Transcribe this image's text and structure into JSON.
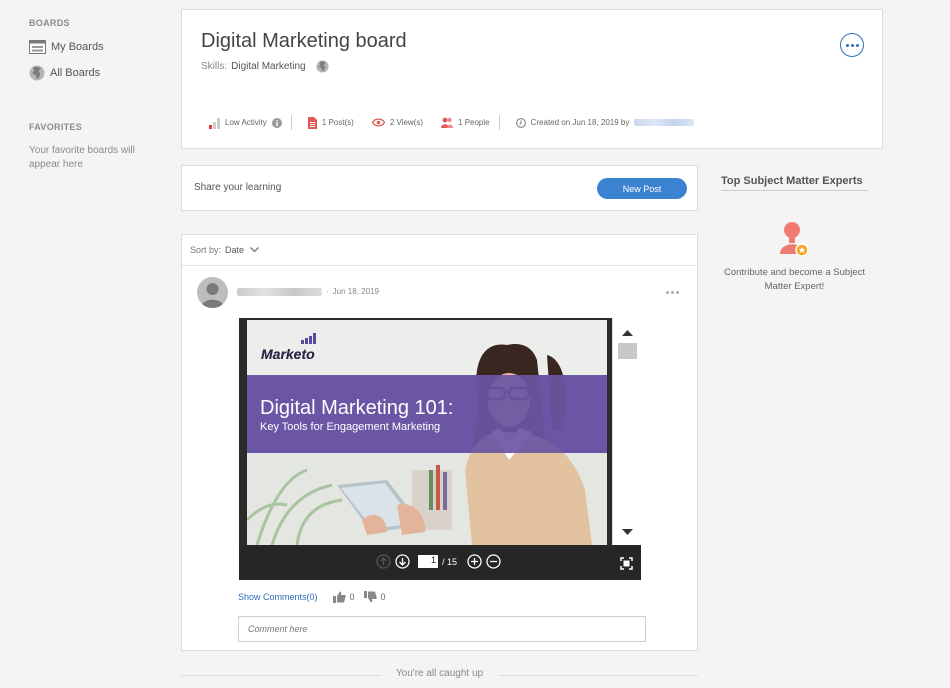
{
  "sidebar": {
    "boards_heading": "BOARDS",
    "items": [
      {
        "label": "My Boards",
        "icon": "boards-icon"
      },
      {
        "label": "All Boards",
        "icon": "globe-icon"
      }
    ],
    "favorites_heading": "FAVORITES",
    "favorites_note": "Your favorite boards will appear here"
  },
  "board": {
    "title": "Digital Marketing board",
    "skills_label": "Skills:",
    "skills_value": "Digital Marketing",
    "stats": {
      "activity": "Low Activity",
      "posts": "1 Post(s)",
      "views": "2 View(s)",
      "people": "1 People",
      "created": "Created on Jun 18, 2019 by"
    }
  },
  "share": {
    "prompt": "Share your learning",
    "new_post_label": "New Post"
  },
  "feed": {
    "sort_label": "Sort by:",
    "sort_value": "Date",
    "post": {
      "date": "Jun 18, 2019",
      "slide": {
        "logo": "Marketo",
        "title": "Digital Marketing 101:",
        "subtitle": "Key Tools for Engagement Marketing"
      },
      "viewer": {
        "current_page": "1",
        "total_pages": "/ 15"
      },
      "show_comments": "Show Comments(0)",
      "likes": "0",
      "dislikes": "0",
      "comment_placeholder": "Comment here"
    },
    "end_text": "You're all caught up"
  },
  "experts": {
    "title": "Top Subject Matter Experts",
    "note": "Contribute and become a Subject Matter Expert!"
  },
  "colors": {
    "accent": "#3b82d0",
    "link": "#2c6fb7",
    "slide_band": "#6a56a4",
    "expert_icon": "#f07b72"
  }
}
